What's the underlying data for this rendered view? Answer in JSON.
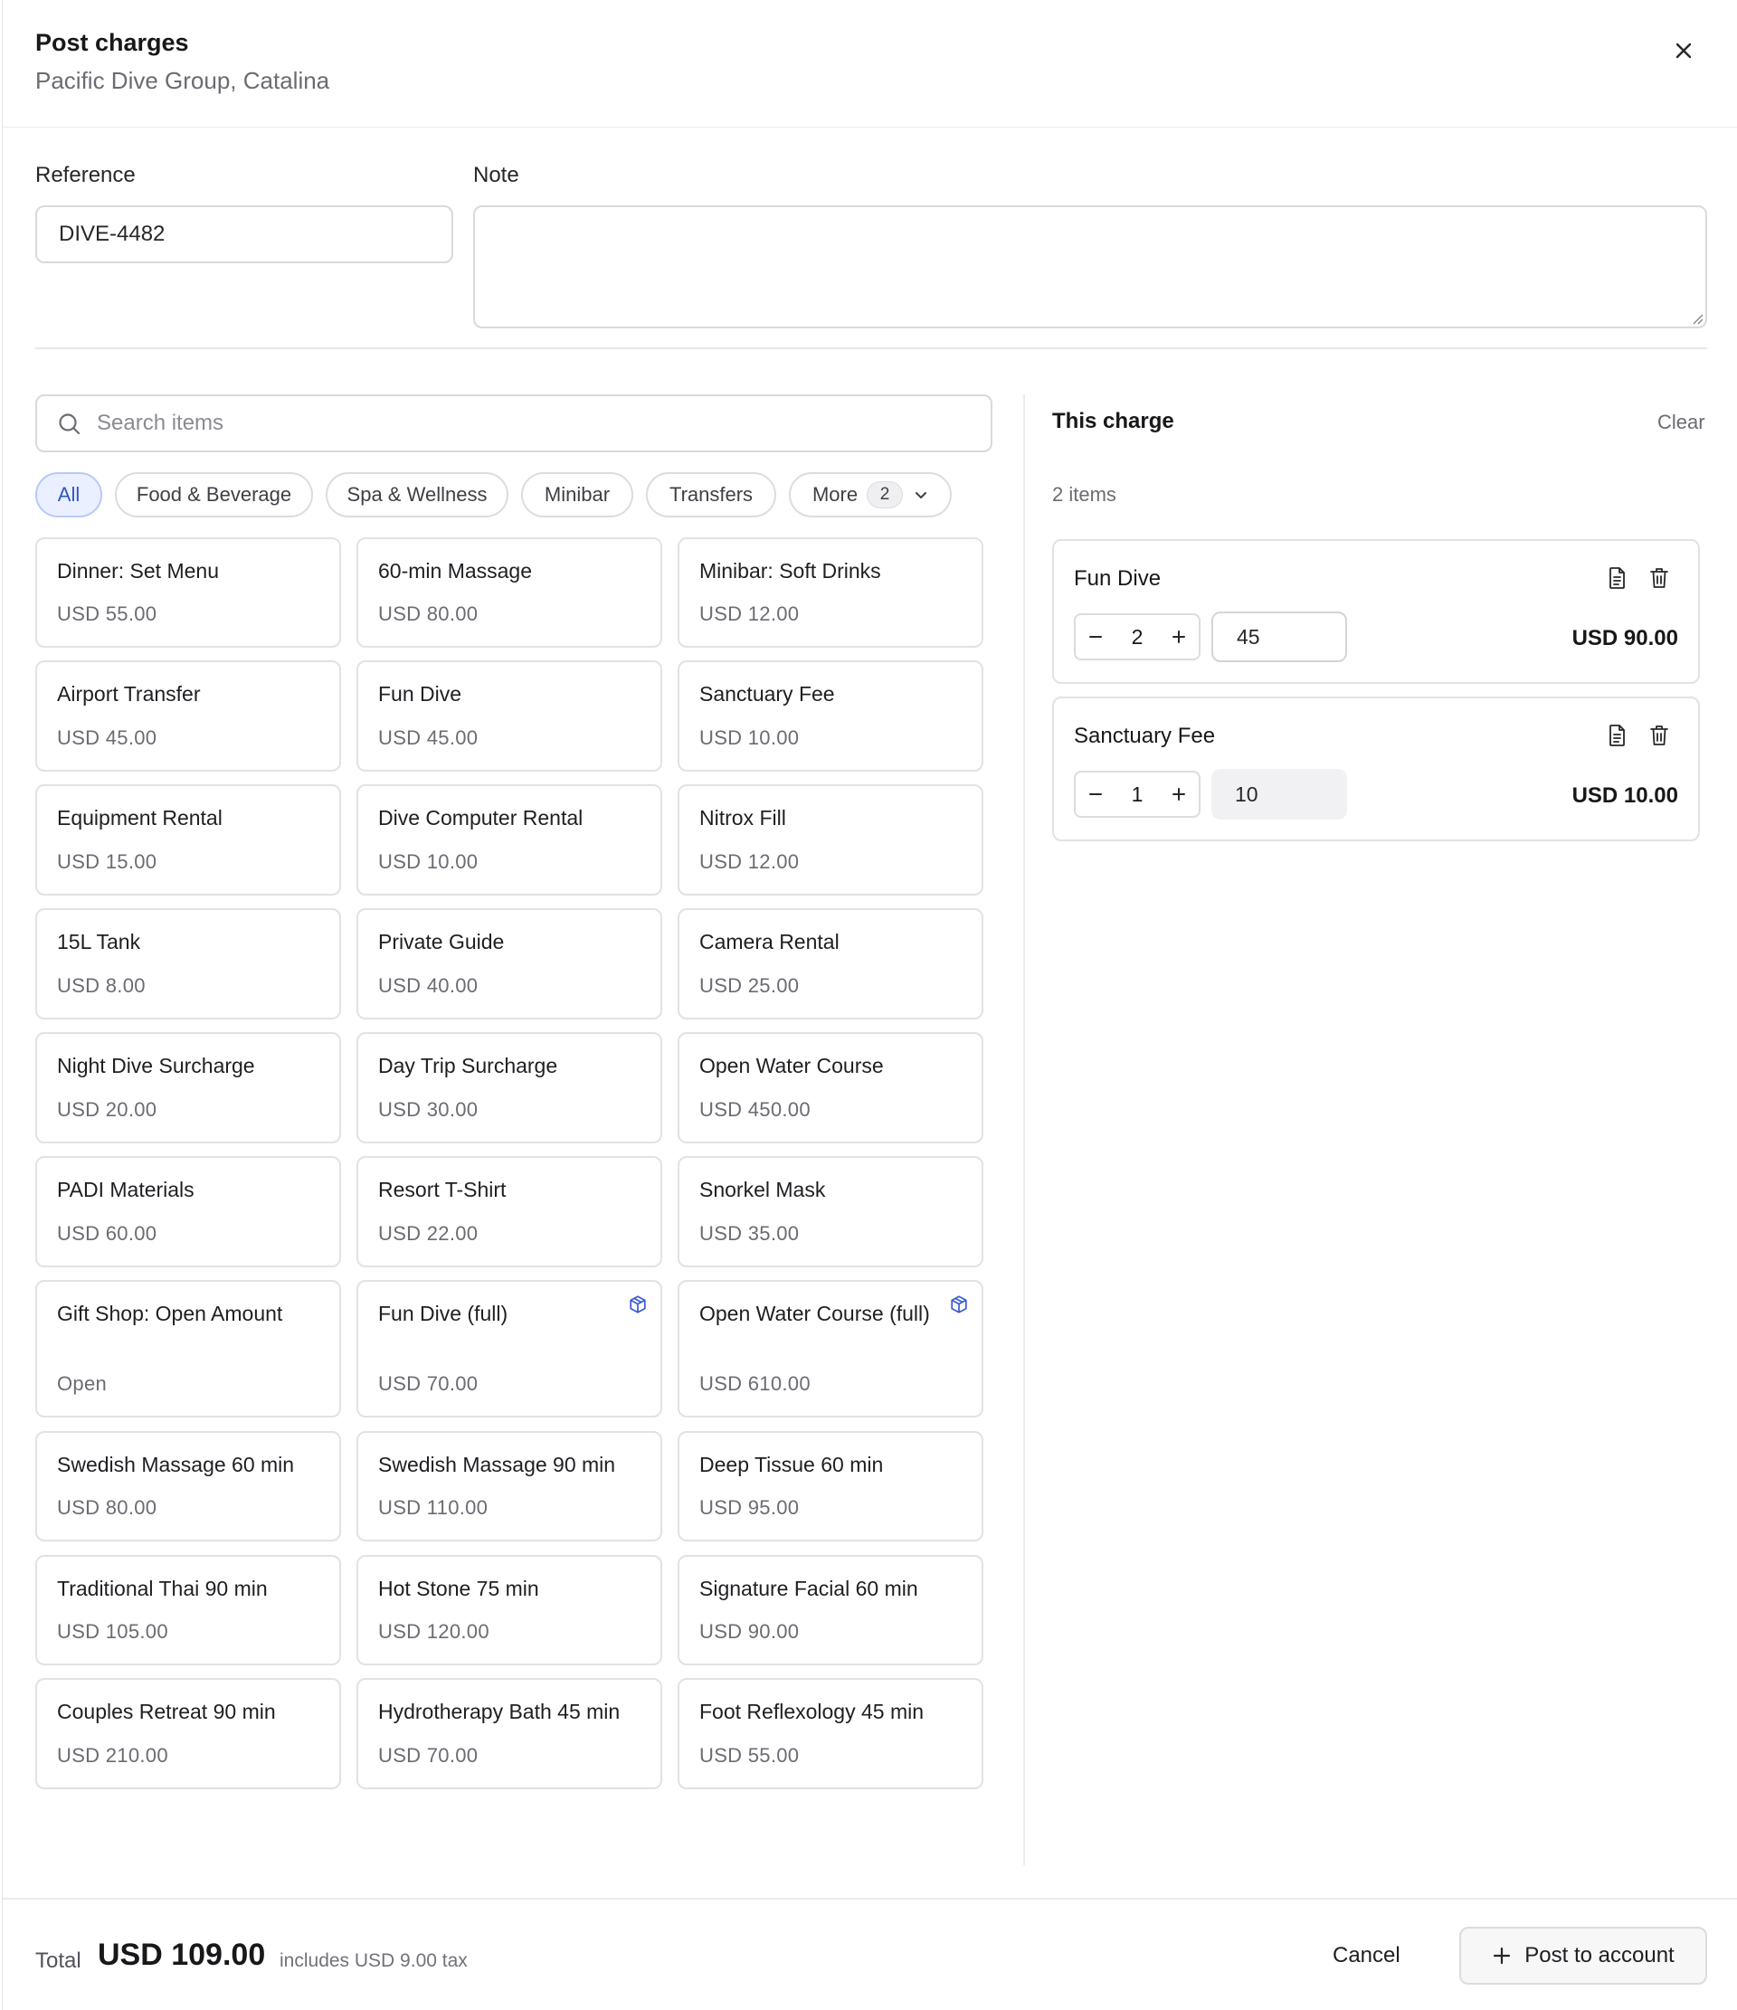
{
  "header": {
    "title": "Post charges",
    "subtitle": "Pacific Dive Group, Catalina"
  },
  "form": {
    "reference_label": "Reference",
    "reference_value": "DIVE-4482",
    "note_label": "Note",
    "note_value": ""
  },
  "search": {
    "placeholder": "Search items"
  },
  "categories": [
    "All",
    "Food & Beverage",
    "Spa & Wellness",
    "Minibar",
    "Transfers"
  ],
  "more": {
    "label": "More",
    "count": "2"
  },
  "items": [
    {
      "name": "Dinner: Set Menu",
      "price": "USD 55.00"
    },
    {
      "name": "60-min Massage",
      "price": "USD 80.00"
    },
    {
      "name": "Minibar: Soft Drinks",
      "price": "USD 12.00"
    },
    {
      "name": "Airport Transfer",
      "price": "USD 45.00"
    },
    {
      "name": "Fun Dive",
      "price": "USD 45.00"
    },
    {
      "name": "Sanctuary Fee",
      "price": "USD 10.00"
    },
    {
      "name": "Equipment Rental",
      "price": "USD 15.00"
    },
    {
      "name": "Dive Computer Rental",
      "price": "USD 10.00"
    },
    {
      "name": "Nitrox Fill",
      "price": "USD 12.00"
    },
    {
      "name": "15L Tank",
      "price": "USD 8.00"
    },
    {
      "name": "Private Guide",
      "price": "USD 40.00"
    },
    {
      "name": "Camera Rental",
      "price": "USD 25.00"
    },
    {
      "name": "Night Dive Surcharge",
      "price": "USD 20.00"
    },
    {
      "name": "Day Trip Surcharge",
      "price": "USD 30.00"
    },
    {
      "name": "Open Water Course",
      "price": "USD 450.00"
    },
    {
      "name": "PADI Materials",
      "price": "USD 60.00"
    },
    {
      "name": "Resort T-Shirt",
      "price": "USD 22.00"
    },
    {
      "name": "Snorkel Mask",
      "price": "USD 35.00"
    },
    {
      "name": "Gift Shop: Open Amount",
      "price": "Open"
    },
    {
      "name": "Fun Dive (full)",
      "price": "USD 70.00",
      "icon": "package-icon"
    },
    {
      "name": "Open Water Course (full)",
      "price": "USD 610.00",
      "icon": "package-icon"
    },
    {
      "name": "Swedish Massage 60 min",
      "price": "USD 80.00"
    },
    {
      "name": "Swedish Massage 90 min",
      "price": "USD 110.00"
    },
    {
      "name": "Deep Tissue 60 min",
      "price": "USD 95.00"
    },
    {
      "name": "Traditional Thai 90 min",
      "price": "USD 105.00"
    },
    {
      "name": "Hot Stone 75 min",
      "price": "USD 120.00"
    },
    {
      "name": "Signature Facial 60 min",
      "price": "USD 90.00"
    },
    {
      "name": "Couples Retreat 90 min",
      "price": "USD 210.00"
    },
    {
      "name": "Hydrotherapy Bath 45 min",
      "price": "USD 70.00"
    },
    {
      "name": "Foot Reflexology 45 min",
      "price": "USD 55.00"
    }
  ],
  "charge": {
    "title": "This charge",
    "clear_label": "Clear",
    "count_label": "2 items",
    "lines": [
      {
        "name": "Fun Dive",
        "qty": "2",
        "unit_price": "45",
        "total": "USD 90.00",
        "price_editable": true
      },
      {
        "name": "Sanctuary Fee",
        "qty": "1",
        "unit_price": "10",
        "total": "USD 10.00",
        "price_editable": false
      }
    ]
  },
  "footer": {
    "total_label": "Total",
    "total_value": "USD 109.00",
    "tax_note": "includes USD 9.00 tax",
    "cancel_label": "Cancel",
    "post_label": "Post to account"
  },
  "colors": {
    "accent": "#2f55c9",
    "accent_bg": "#eaf0ff",
    "package_icon": "#3b5bd6"
  }
}
